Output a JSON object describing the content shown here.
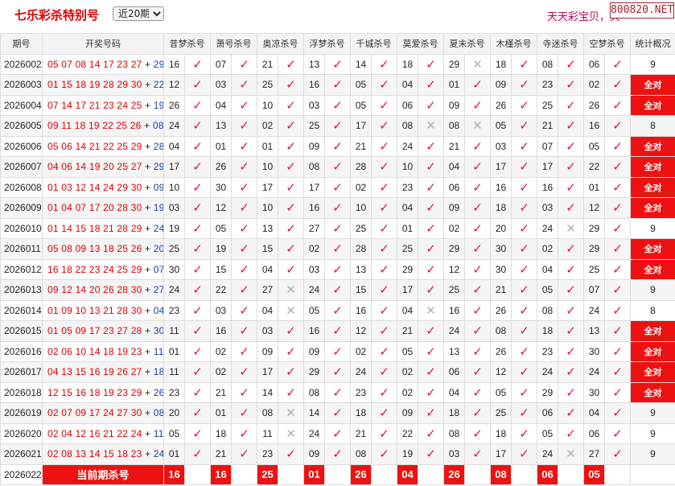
{
  "header": {
    "title": "七乐彩杀特别号",
    "period_selected": "近20期",
    "period_options": [
      "近20期"
    ],
    "slogan": "天天彩宝贝，天",
    "badge": "800820.NET"
  },
  "columns": {
    "issue": "期号",
    "draw": "开奖号码",
    "experts": [
      "昔梦杀号",
      "萧号杀号",
      "奥凉杀号",
      "浮梦杀号",
      "千城杀号",
      "莫爱杀号",
      "夏末杀号",
      "木槿杀号",
      "寺迷杀号",
      "空梦杀号"
    ],
    "stat": "统计概况"
  },
  "rows": [
    {
      "issue": "2026002",
      "main": "05 07 08 14 17 23 27",
      "plus": "+",
      "special": "29",
      "kills": [
        [
          "16",
          "ok"
        ],
        [
          "07",
          "ok"
        ],
        [
          "21",
          "ok"
        ],
        [
          "13",
          "ok"
        ],
        [
          "14",
          "ok"
        ],
        [
          "18",
          "ok"
        ],
        [
          "29",
          "no"
        ],
        [
          "18",
          "ok"
        ],
        [
          "08",
          "ok"
        ],
        [
          "06",
          "ok"
        ]
      ],
      "stat": "9",
      "all": false
    },
    {
      "issue": "2026003",
      "main": "01 15 18 19 28 29 30",
      "plus": "+",
      "special": "22",
      "kills": [
        [
          "12",
          "ok"
        ],
        [
          "03",
          "ok"
        ],
        [
          "25",
          "ok"
        ],
        [
          "16",
          "ok"
        ],
        [
          "05",
          "ok"
        ],
        [
          "04",
          "ok"
        ],
        [
          "01",
          "ok"
        ],
        [
          "09",
          "ok"
        ],
        [
          "23",
          "ok"
        ],
        [
          "02",
          "ok"
        ]
      ],
      "stat": "全对",
      "all": true
    },
    {
      "issue": "2026004",
      "main": "07 14 17 21 23 24 25",
      "plus": "+",
      "special": "19",
      "kills": [
        [
          "26",
          "ok"
        ],
        [
          "04",
          "ok"
        ],
        [
          "10",
          "ok"
        ],
        [
          "03",
          "ok"
        ],
        [
          "05",
          "ok"
        ],
        [
          "06",
          "ok"
        ],
        [
          "09",
          "ok"
        ],
        [
          "26",
          "ok"
        ],
        [
          "25",
          "ok"
        ],
        [
          "26",
          "ok"
        ]
      ],
      "stat": "全对",
      "all": true
    },
    {
      "issue": "2026005",
      "main": "09 11 18 19 22 25 26",
      "plus": "+",
      "special": "08",
      "kills": [
        [
          "24",
          "ok"
        ],
        [
          "13",
          "ok"
        ],
        [
          "02",
          "ok"
        ],
        [
          "25",
          "ok"
        ],
        [
          "17",
          "ok"
        ],
        [
          "08",
          "no"
        ],
        [
          "08",
          "no"
        ],
        [
          "05",
          "ok"
        ],
        [
          "21",
          "ok"
        ],
        [
          "16",
          "ok"
        ]
      ],
      "stat": "8",
      "all": false
    },
    {
      "issue": "2026006",
      "main": "05 06 14 21 22 25 29",
      "plus": "+",
      "special": "28",
      "kills": [
        [
          "04",
          "ok"
        ],
        [
          "01",
          "ok"
        ],
        [
          "01",
          "ok"
        ],
        [
          "09",
          "ok"
        ],
        [
          "21",
          "ok"
        ],
        [
          "24",
          "ok"
        ],
        [
          "21",
          "ok"
        ],
        [
          "03",
          "ok"
        ],
        [
          "07",
          "ok"
        ],
        [
          "05",
          "ok"
        ]
      ],
      "stat": "全对",
      "all": true
    },
    {
      "issue": "2026007",
      "main": "04 06 14 19 20 25 27",
      "plus": "+",
      "special": "29",
      "kills": [
        [
          "17",
          "ok"
        ],
        [
          "26",
          "ok"
        ],
        [
          "10",
          "ok"
        ],
        [
          "08",
          "ok"
        ],
        [
          "28",
          "ok"
        ],
        [
          "10",
          "ok"
        ],
        [
          "04",
          "ok"
        ],
        [
          "17",
          "ok"
        ],
        [
          "17",
          "ok"
        ],
        [
          "22",
          "ok"
        ]
      ],
      "stat": "全对",
      "all": true
    },
    {
      "issue": "2026008",
      "main": "01 03 12 14 24 29 30",
      "plus": "+",
      "special": "09",
      "kills": [
        [
          "10",
          "ok"
        ],
        [
          "30",
          "ok"
        ],
        [
          "17",
          "ok"
        ],
        [
          "17",
          "ok"
        ],
        [
          "02",
          "ok"
        ],
        [
          "23",
          "ok"
        ],
        [
          "06",
          "ok"
        ],
        [
          "16",
          "ok"
        ],
        [
          "16",
          "ok"
        ],
        [
          "01",
          "ok"
        ]
      ],
      "stat": "全对",
      "all": true
    },
    {
      "issue": "2026009",
      "main": "01 04 07 17 20 28 30",
      "plus": "+",
      "special": "19",
      "kills": [
        [
          "03",
          "ok"
        ],
        [
          "12",
          "ok"
        ],
        [
          "10",
          "ok"
        ],
        [
          "16",
          "ok"
        ],
        [
          "10",
          "ok"
        ],
        [
          "04",
          "ok"
        ],
        [
          "09",
          "ok"
        ],
        [
          "18",
          "ok"
        ],
        [
          "03",
          "ok"
        ],
        [
          "12",
          "ok"
        ]
      ],
      "stat": "全对",
      "all": true
    },
    {
      "issue": "2026010",
      "main": "01 14 15 18 21 28 29",
      "plus": "+",
      "special": "24",
      "kills": [
        [
          "19",
          "ok"
        ],
        [
          "05",
          "ok"
        ],
        [
          "13",
          "ok"
        ],
        [
          "27",
          "ok"
        ],
        [
          "25",
          "ok"
        ],
        [
          "01",
          "ok"
        ],
        [
          "02",
          "ok"
        ],
        [
          "20",
          "ok"
        ],
        [
          "24",
          "no"
        ],
        [
          "29",
          "ok"
        ]
      ],
      "stat": "9",
      "all": false
    },
    {
      "issue": "2026011",
      "main": "05 08 09 13 18 25 26",
      "plus": "+",
      "special": "20",
      "kills": [
        [
          "25",
          "ok"
        ],
        [
          "19",
          "ok"
        ],
        [
          "15",
          "ok"
        ],
        [
          "02",
          "ok"
        ],
        [
          "28",
          "ok"
        ],
        [
          "25",
          "ok"
        ],
        [
          "29",
          "ok"
        ],
        [
          "30",
          "ok"
        ],
        [
          "02",
          "ok"
        ],
        [
          "29",
          "ok"
        ]
      ],
      "stat": "全对",
      "all": true
    },
    {
      "issue": "2026012",
      "main": "16 18 22 23 24 25 29",
      "plus": "+",
      "special": "07",
      "kills": [
        [
          "30",
          "ok"
        ],
        [
          "15",
          "ok"
        ],
        [
          "04",
          "ok"
        ],
        [
          "03",
          "ok"
        ],
        [
          "13",
          "ok"
        ],
        [
          "29",
          "ok"
        ],
        [
          "12",
          "ok"
        ],
        [
          "30",
          "ok"
        ],
        [
          "04",
          "ok"
        ],
        [
          "25",
          "ok"
        ]
      ],
      "stat": "全对",
      "all": true
    },
    {
      "issue": "2026013",
      "main": "09 12 14 20 26 28 30",
      "plus": "+",
      "special": "27",
      "kills": [
        [
          "24",
          "ok"
        ],
        [
          "22",
          "ok"
        ],
        [
          "27",
          "no"
        ],
        [
          "24",
          "ok"
        ],
        [
          "15",
          "ok"
        ],
        [
          "17",
          "ok"
        ],
        [
          "25",
          "ok"
        ],
        [
          "21",
          "ok"
        ],
        [
          "05",
          "ok"
        ],
        [
          "07",
          "ok"
        ]
      ],
      "stat": "9",
      "all": false
    },
    {
      "issue": "2026014",
      "main": "01 09 10 13 21 28 30",
      "plus": "+",
      "special": "04",
      "kills": [
        [
          "23",
          "ok"
        ],
        [
          "03",
          "ok"
        ],
        [
          "04",
          "no"
        ],
        [
          "05",
          "ok"
        ],
        [
          "16",
          "ok"
        ],
        [
          "04",
          "no"
        ],
        [
          "16",
          "ok"
        ],
        [
          "26",
          "ok"
        ],
        [
          "08",
          "ok"
        ],
        [
          "24",
          "ok"
        ]
      ],
      "stat": "8",
      "all": false
    },
    {
      "issue": "2026015",
      "main": "01 05 09 17 23 27 28",
      "plus": "+",
      "special": "30",
      "kills": [
        [
          "11",
          "ok"
        ],
        [
          "16",
          "ok"
        ],
        [
          "03",
          "ok"
        ],
        [
          "16",
          "ok"
        ],
        [
          "12",
          "ok"
        ],
        [
          "21",
          "ok"
        ],
        [
          "24",
          "ok"
        ],
        [
          "08",
          "ok"
        ],
        [
          "18",
          "ok"
        ],
        [
          "13",
          "ok"
        ]
      ],
      "stat": "全对",
      "all": true
    },
    {
      "issue": "2026016",
      "main": "02 06 10 14 18 19 23",
      "plus": "+",
      "special": "11",
      "kills": [
        [
          "01",
          "ok"
        ],
        [
          "02",
          "ok"
        ],
        [
          "09",
          "ok"
        ],
        [
          "09",
          "ok"
        ],
        [
          "02",
          "ok"
        ],
        [
          "05",
          "ok"
        ],
        [
          "13",
          "ok"
        ],
        [
          "26",
          "ok"
        ],
        [
          "23",
          "ok"
        ],
        [
          "30",
          "ok"
        ]
      ],
      "stat": "全对",
      "all": true
    },
    {
      "issue": "2026017",
      "main": "04 13 15 16 19 26 27",
      "plus": "+",
      "special": "18",
      "kills": [
        [
          "11",
          "ok"
        ],
        [
          "02",
          "ok"
        ],
        [
          "17",
          "ok"
        ],
        [
          "29",
          "ok"
        ],
        [
          "24",
          "ok"
        ],
        [
          "02",
          "ok"
        ],
        [
          "06",
          "ok"
        ],
        [
          "12",
          "ok"
        ],
        [
          "24",
          "ok"
        ],
        [
          "24",
          "ok"
        ]
      ],
      "stat": "全对",
      "all": true
    },
    {
      "issue": "2026018",
      "main": "12 15 16 18 19 23 29",
      "plus": "+",
      "special": "26",
      "kills": [
        [
          "23",
          "ok"
        ],
        [
          "21",
          "ok"
        ],
        [
          "14",
          "ok"
        ],
        [
          "08",
          "ok"
        ],
        [
          "23",
          "ok"
        ],
        [
          "02",
          "ok"
        ],
        [
          "04",
          "ok"
        ],
        [
          "05",
          "ok"
        ],
        [
          "29",
          "ok"
        ],
        [
          "30",
          "ok"
        ]
      ],
      "stat": "全对",
      "all": true
    },
    {
      "issue": "2026019",
      "main": "02 07 09 17 24 27 30",
      "plus": "+",
      "special": "08",
      "kills": [
        [
          "20",
          "ok"
        ],
        [
          "01",
          "ok"
        ],
        [
          "08",
          "no"
        ],
        [
          "14",
          "ok"
        ],
        [
          "18",
          "ok"
        ],
        [
          "09",
          "ok"
        ],
        [
          "18",
          "ok"
        ],
        [
          "25",
          "ok"
        ],
        [
          "06",
          "ok"
        ],
        [
          "04",
          "ok"
        ]
      ],
      "stat": "9",
      "all": false
    },
    {
      "issue": "2026020",
      "main": "02 04 12 16 21 22 24",
      "plus": "+",
      "special": "11",
      "kills": [
        [
          "05",
          "ok"
        ],
        [
          "18",
          "ok"
        ],
        [
          "11",
          "no"
        ],
        [
          "24",
          "ok"
        ],
        [
          "21",
          "ok"
        ],
        [
          "22",
          "ok"
        ],
        [
          "08",
          "ok"
        ],
        [
          "18",
          "ok"
        ],
        [
          "05",
          "ok"
        ],
        [
          "06",
          "ok"
        ]
      ],
      "stat": "9",
      "all": false
    },
    {
      "issue": "2026021",
      "main": "02 08 13 14 15 18 23",
      "plus": "+",
      "special": "24",
      "kills": [
        [
          "01",
          "ok"
        ],
        [
          "21",
          "ok"
        ],
        [
          "23",
          "ok"
        ],
        [
          "09",
          "ok"
        ],
        [
          "08",
          "ok"
        ],
        [
          "19",
          "ok"
        ],
        [
          "03",
          "ok"
        ],
        [
          "17",
          "ok"
        ],
        [
          "24",
          "no"
        ],
        [
          "27",
          "ok"
        ]
      ],
      "stat": "9",
      "all": false
    }
  ],
  "current": {
    "issue": "2026022",
    "label": "当前期杀号",
    "kills": [
      "16",
      "16",
      "25",
      "01",
      "26",
      "04",
      "26",
      "08",
      "06",
      "05"
    ]
  },
  "glyphs": {
    "ok": "✓",
    "no": "✕"
  }
}
